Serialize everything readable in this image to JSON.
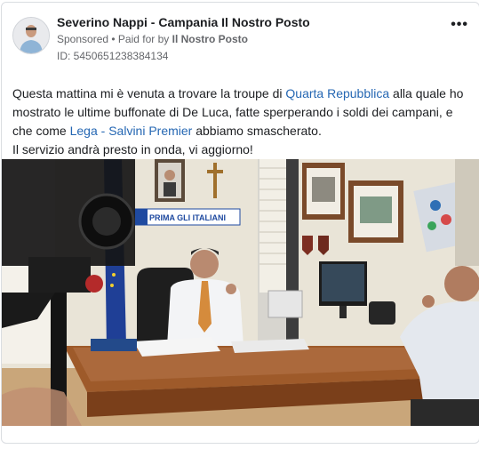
{
  "post": {
    "author": "Severino Nappi - Campania Il Nostro Posto",
    "sponsored": "Sponsored",
    "separator": " • ",
    "paid_for_prefix": "Paid for by ",
    "paid_for_name": "Il Nostro Posto",
    "ad_id": "ID: 5450651238384134",
    "more_label": "•••"
  },
  "body": {
    "p1": "Questa mattina mi è venuta a trovare la troupe di ",
    "link1": "Quarta Repubblica",
    "p2": " alla quale ho mostrato le ultime buffonate di De Luca, fatte sperperando i soldi dei campani, e che come ",
    "link2": "Lega",
    "p3": " - ",
    "link3": "Salvini Premier",
    "p4": " abbiamo smascherato.",
    "p5": "Il servizio andrà presto in onda, vi aggiorno!"
  },
  "photo": {
    "sign_text": "PRIMA GLI ITALIANI"
  },
  "colors": {
    "link": "#2567b3",
    "secondary_text": "#65676b"
  }
}
